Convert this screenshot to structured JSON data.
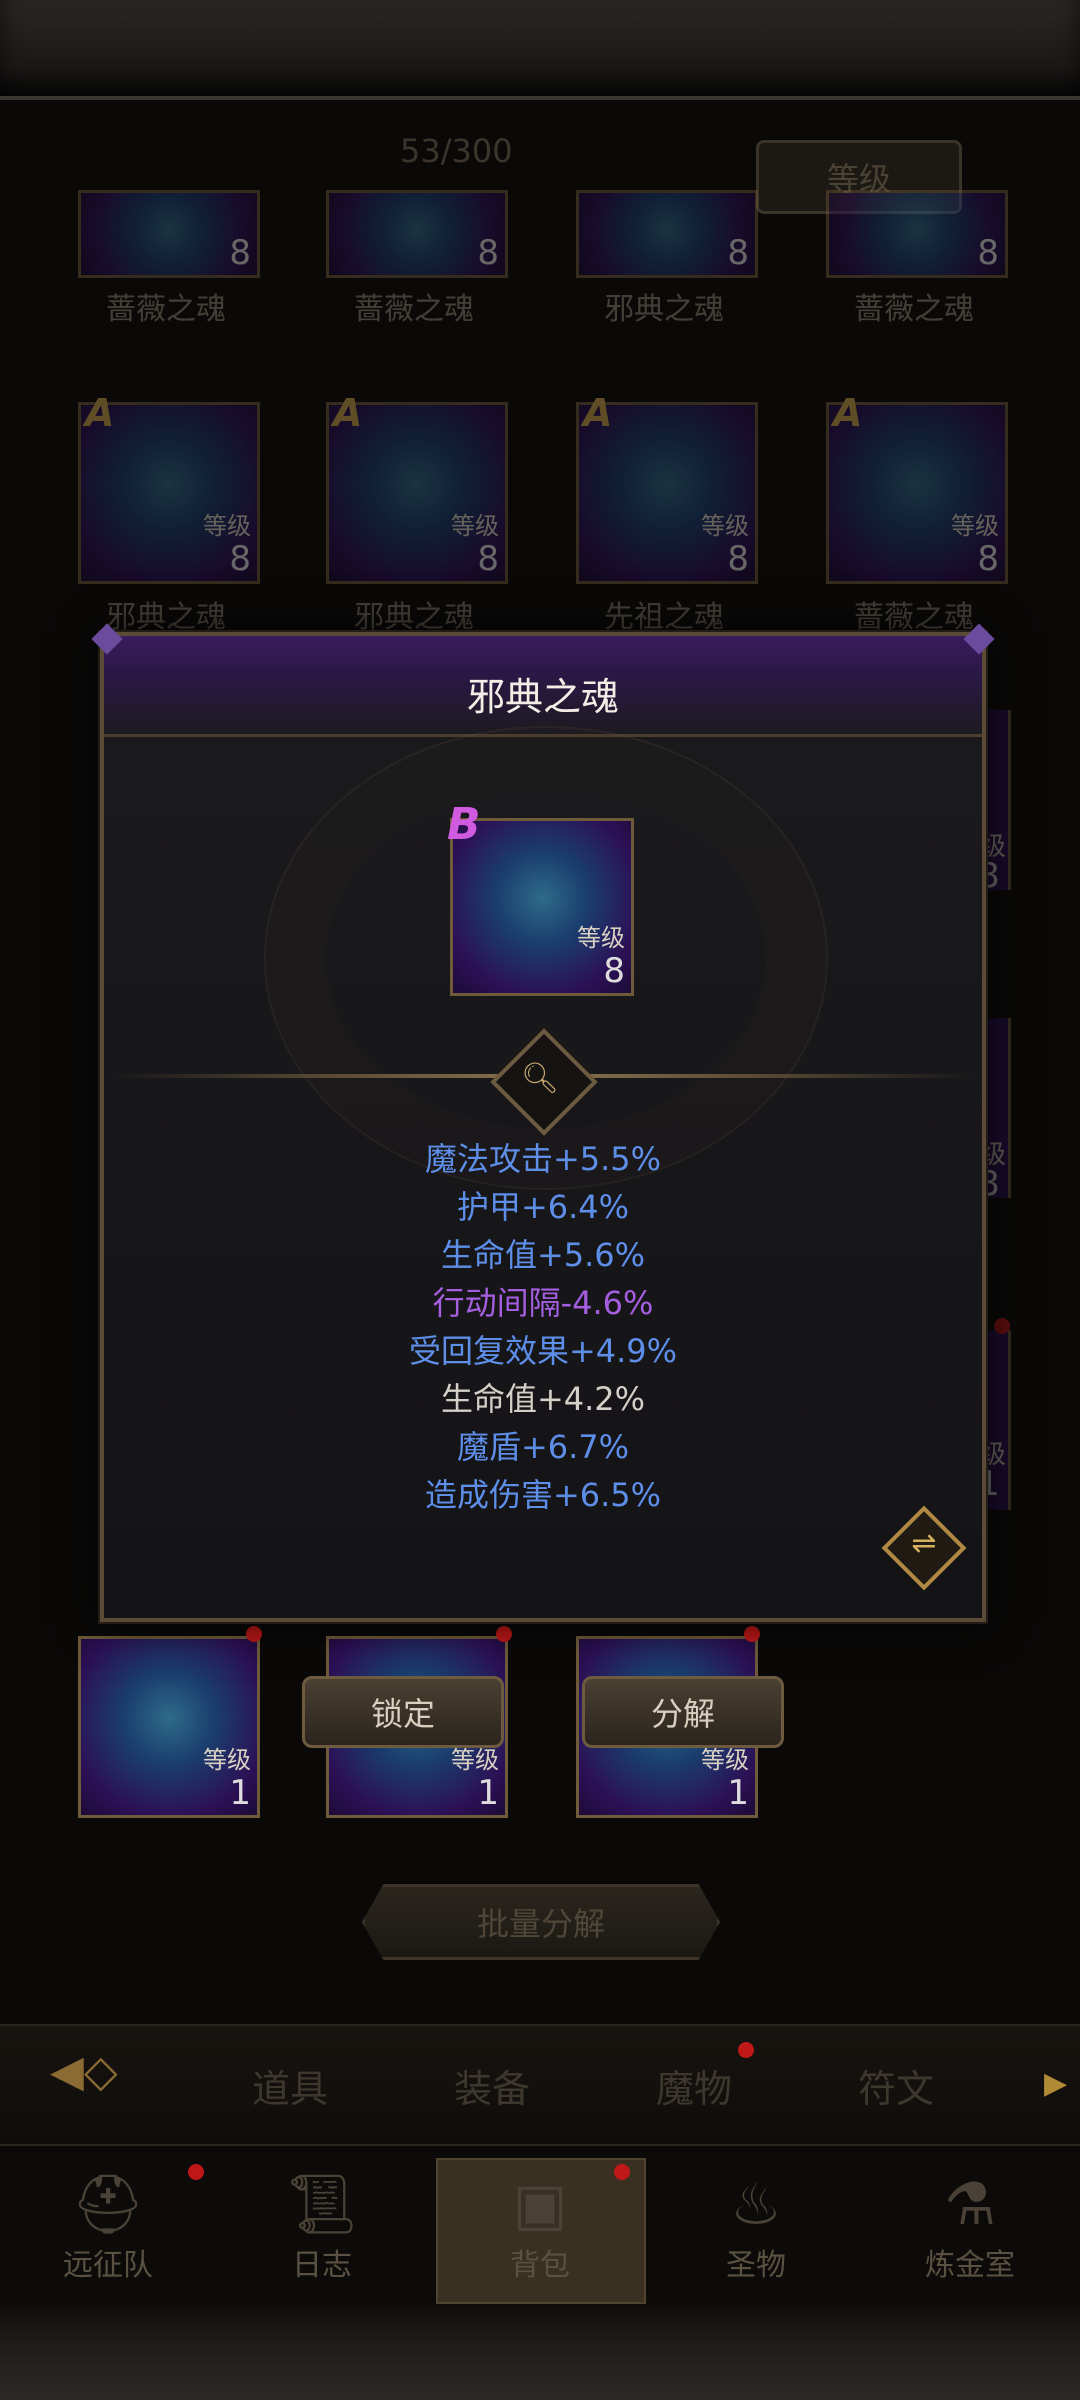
{
  "header": {
    "bag_count": "53/300",
    "sort_label": "等级"
  },
  "grid": {
    "level_label": "等级",
    "grade_a": "A",
    "row0": [
      {
        "name": "蔷薇之魂",
        "level": "8"
      },
      {
        "name": "蔷薇之魂",
        "level": "8"
      },
      {
        "name": "邪典之魂",
        "level": "8"
      },
      {
        "name": "蔷薇之魂",
        "level": "8"
      }
    ],
    "row1": [
      {
        "name": "邪典之魂",
        "level": "8"
      },
      {
        "name": "邪典之魂",
        "level": "8"
      },
      {
        "name": "先祖之魂",
        "level": "8"
      },
      {
        "name": "蔷薇之魂",
        "level": "8"
      }
    ],
    "right_edge": [
      {
        "label": "级",
        "level": "8"
      },
      {
        "label": "级",
        "level": "8"
      },
      {
        "label": "级",
        "level": "1"
      }
    ],
    "left_edge_level": "8",
    "row_bottom": [
      {
        "level": "1"
      },
      {
        "level": "1"
      },
      {
        "level": "1"
      }
    ]
  },
  "popup": {
    "title": "邪典之魂",
    "item_grade": "B",
    "item_level_label": "等级",
    "item_level": "8",
    "stats": [
      {
        "text": "魔法攻击+5.5%",
        "color": "#5d8ee8"
      },
      {
        "text": "护甲+6.4%",
        "color": "#5d8ee8"
      },
      {
        "text": "生命值+5.6%",
        "color": "#5d8ee8"
      },
      {
        "text": "行动间隔-4.6%",
        "color": "#a55ee0"
      },
      {
        "text": "受回复效果+4.9%",
        "color": "#5d8ee8"
      },
      {
        "text": "生命值+4.2%",
        "color": "#d4d0c8"
      },
      {
        "text": "魔盾+6.7%",
        "color": "#5d8ee8"
      },
      {
        "text": "造成伤害+6.5%",
        "color": "#5d8ee8"
      }
    ]
  },
  "actions": {
    "lock_label": "锁定",
    "decompose_label": "分解",
    "batch_label": "批量分解"
  },
  "tabs": [
    "道具",
    "装备",
    "魔物",
    "符文"
  ],
  "nav": [
    "远征队",
    "日志",
    "背包",
    "圣物",
    "炼金室"
  ],
  "icons": {
    "magnify": "search-icon",
    "expand": "expand-collapse-icon"
  }
}
